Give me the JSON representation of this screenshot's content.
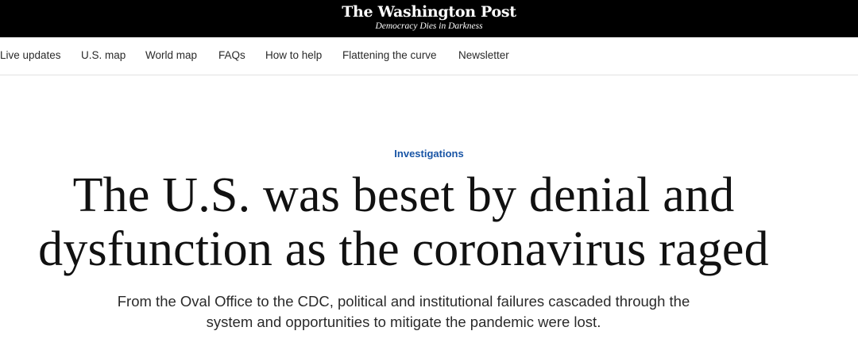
{
  "masthead": {
    "logo": "The Washington Post",
    "tagline": "Democracy Dies in Darkness",
    "background": "#000000"
  },
  "nav": {
    "items": [
      {
        "label": "Live updates"
      },
      {
        "label": "U.S. map"
      },
      {
        "label": "World map"
      },
      {
        "label": "FAQs"
      },
      {
        "label": "How to help"
      },
      {
        "label": "Flattening the curve"
      },
      {
        "label": "Newsletter"
      }
    ]
  },
  "article": {
    "kicker": "Investigations",
    "kicker_color": "#1955a5",
    "headline_line1": "The U.S. was beset by denial and",
    "headline_line2": "dysfunction as the coronavirus raged",
    "dek_line1": "From the Oval Office to the CDC, political and institutional failures cascaded through the",
    "dek_line2": "system and opportunities to mitigate the pandemic were lost."
  }
}
